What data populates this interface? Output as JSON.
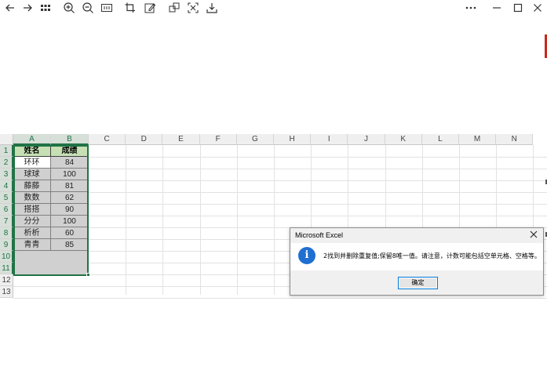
{
  "viewer_toolbar": {
    "icons": [
      "back-arrow-icon",
      "forward-arrow-icon",
      "grid-view-icon",
      "zoom-in-icon",
      "zoom-out-icon",
      "fit-width-icon",
      "crop-icon",
      "edit-icon",
      "copy-icon",
      "scan-icon",
      "download-icon",
      "more-icon",
      "minimize-icon",
      "maximize-icon",
      "close-icon"
    ]
  },
  "sheet": {
    "columns": [
      "A",
      "B",
      "C",
      "D",
      "E",
      "F",
      "G",
      "H",
      "I",
      "J",
      "K",
      "L",
      "M",
      "N"
    ],
    "rows": [
      "1",
      "2",
      "3",
      "4",
      "5",
      "6",
      "7",
      "8",
      "9",
      "10",
      "11",
      "12",
      "13"
    ],
    "header": {
      "name": "姓名",
      "score": "成绩"
    },
    "data": [
      {
        "name": "环环",
        "score": "84"
      },
      {
        "name": "球球",
        "score": "100"
      },
      {
        "name": "藤藤",
        "score": "81"
      },
      {
        "name": "数数",
        "score": "62"
      },
      {
        "name": "搭搭",
        "score": "90"
      },
      {
        "name": "分分",
        "score": "100"
      },
      {
        "name": "析析",
        "score": "60"
      },
      {
        "name": "青青",
        "score": "85"
      }
    ],
    "header_fill": "#c6e0b4",
    "selection_color": "#217346"
  },
  "dialog": {
    "title": "Microsoft Excel",
    "message": "2找到并删除重复值;保留8唯一值。请注意，计数可能包括空单元格、空格等。",
    "ok_label": "确定",
    "icon": "info-icon"
  }
}
